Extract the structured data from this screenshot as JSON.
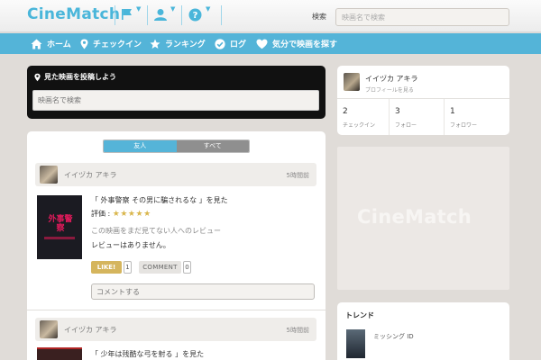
{
  "header": {
    "logo": "CineMatch",
    "search_label": "検索",
    "search_placeholder": "映画名で検索",
    "icons": [
      "flag-icon",
      "user-icon",
      "help-icon"
    ]
  },
  "nav": {
    "items": [
      {
        "label": "ホーム",
        "icon": "home-icon"
      },
      {
        "label": "チェックイン",
        "icon": "pin-icon"
      },
      {
        "label": "ランキング",
        "icon": "star-icon"
      },
      {
        "label": "ログ",
        "icon": "check-icon"
      },
      {
        "label": "気分で映画を探す",
        "icon": "heart-icon"
      }
    ]
  },
  "post_box": {
    "title": "見た映画を投稿しよう",
    "placeholder": "映画名で検索"
  },
  "timeline": {
    "tabs": [
      "友人",
      "すべて"
    ],
    "active_tab": "友人",
    "posts": [
      {
        "user": "イイヅカ アキラ",
        "time": "5時間前",
        "poster_text": "外事警察",
        "movie": "「 外事警察 その男に騙されるな 」を見た",
        "rating_label": "評価 :",
        "stars": "★★★★★",
        "review_title": "この映画をまだ見てない人へのレビュー",
        "review_text": "レビューはありません。",
        "like_label": "LIKE!",
        "like_count": "1",
        "comment_label": "COMMENT",
        "comment_count": "0",
        "comment_placeholder": "コメントする"
      },
      {
        "user": "イイヅカ アキラ",
        "time": "5時間前",
        "movie": "「 少年は残酷な弓を射る 」を見た"
      }
    ]
  },
  "profile": {
    "name": "イイヅカ アキラ",
    "link": "プロフィールを見る",
    "stats": [
      {
        "value": "2",
        "label": "チェックイン"
      },
      {
        "value": "3",
        "label": "フォロー"
      },
      {
        "value": "1",
        "label": "フォロワー"
      }
    ]
  },
  "ad": {
    "logo": "CineMatch"
  },
  "trend": {
    "title": "トレンド",
    "items": [
      {
        "title": "ミッシング ID"
      }
    ]
  },
  "colors": {
    "accent": "#54b4d8",
    "background": "#e0dcd8",
    "like": "#d5b55d",
    "stars": "#d9b64c"
  }
}
